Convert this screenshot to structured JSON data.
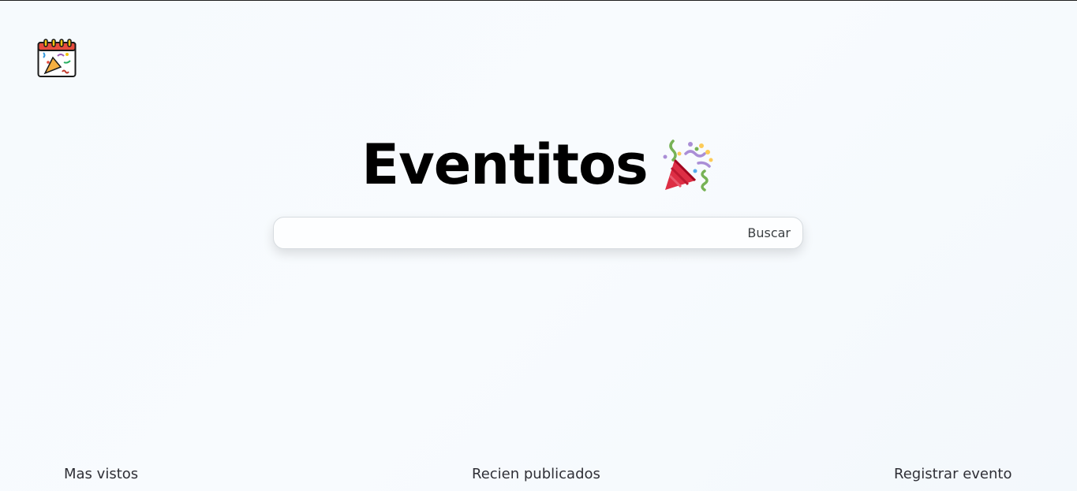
{
  "app": {
    "logo_icon": "calendar-party-icon",
    "title": "Eventitos",
    "title_icon": "party-popper-icon"
  },
  "search": {
    "value": "",
    "placeholder": "",
    "button_label": "Buscar"
  },
  "bottom_nav": {
    "items": [
      {
        "label": "Mas vistos"
      },
      {
        "label": "Recien publicados"
      },
      {
        "label": "Registrar evento"
      }
    ]
  },
  "colors": {
    "background": "#f6fafd",
    "title": "#000000",
    "text": "#2f2f36",
    "search_border": "#d7dce0"
  }
}
